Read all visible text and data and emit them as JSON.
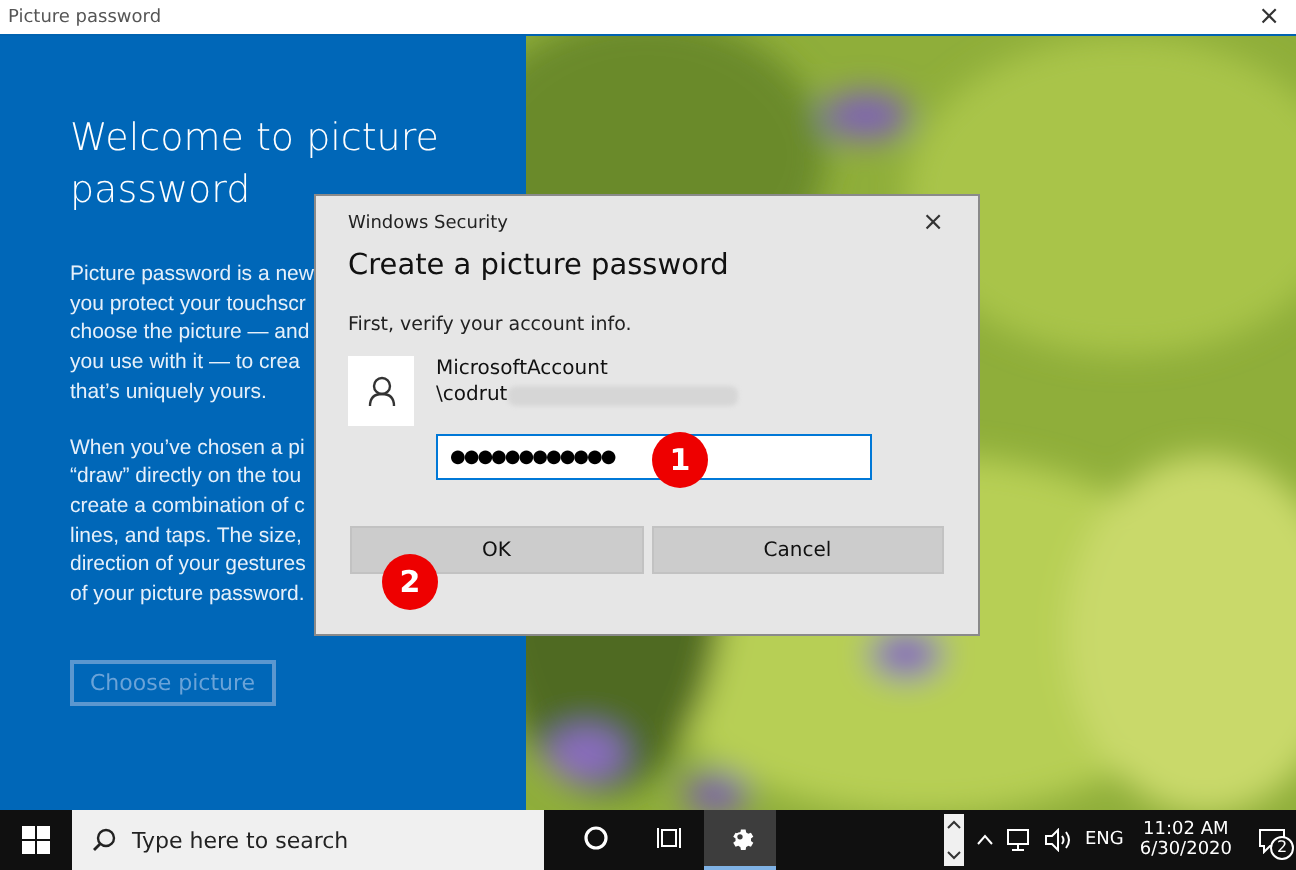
{
  "window": {
    "title": "Picture password",
    "close": "×"
  },
  "panel": {
    "heading": "Welcome to picture password",
    "paragraphs": [
      [
        "Picture password is a new",
        "you protect your touchscr",
        "choose the picture — and",
        "you use with it — to crea",
        "that’s uniquely yours."
      ],
      [
        "When you’ve chosen a pi",
        "“draw” directly on the tou",
        "create a combination of c",
        "lines, and taps. The size,",
        "direction of your gestures",
        "of your picture password."
      ]
    ],
    "button": {
      "label": "Choose picture",
      "disabled": true
    }
  },
  "background": {
    "kind": "picture"
  },
  "dialog": {
    "title": "Windows Security",
    "close": "×",
    "heading": "Create a picture password",
    "prompt": "First, verify your account info.",
    "account_lines": [
      "MicrosoftAccount",
      "\\codrut"
    ],
    "password": {
      "value": "●●●●●●●●●●●●"
    },
    "buttons": [
      "OK",
      "Cancel"
    ]
  },
  "callouts": [
    "1",
    "2"
  ],
  "taskbar": {
    "search_placeholder": "Type here to search",
    "apps": [
      {
        "kind": "cortana",
        "selected": false
      },
      {
        "kind": "taskview",
        "selected": false
      },
      {
        "kind": "settings",
        "selected": true
      }
    ],
    "language": "ENG",
    "time": "11:02 AM",
    "date": "6/30/2020",
    "notifications": "2"
  }
}
